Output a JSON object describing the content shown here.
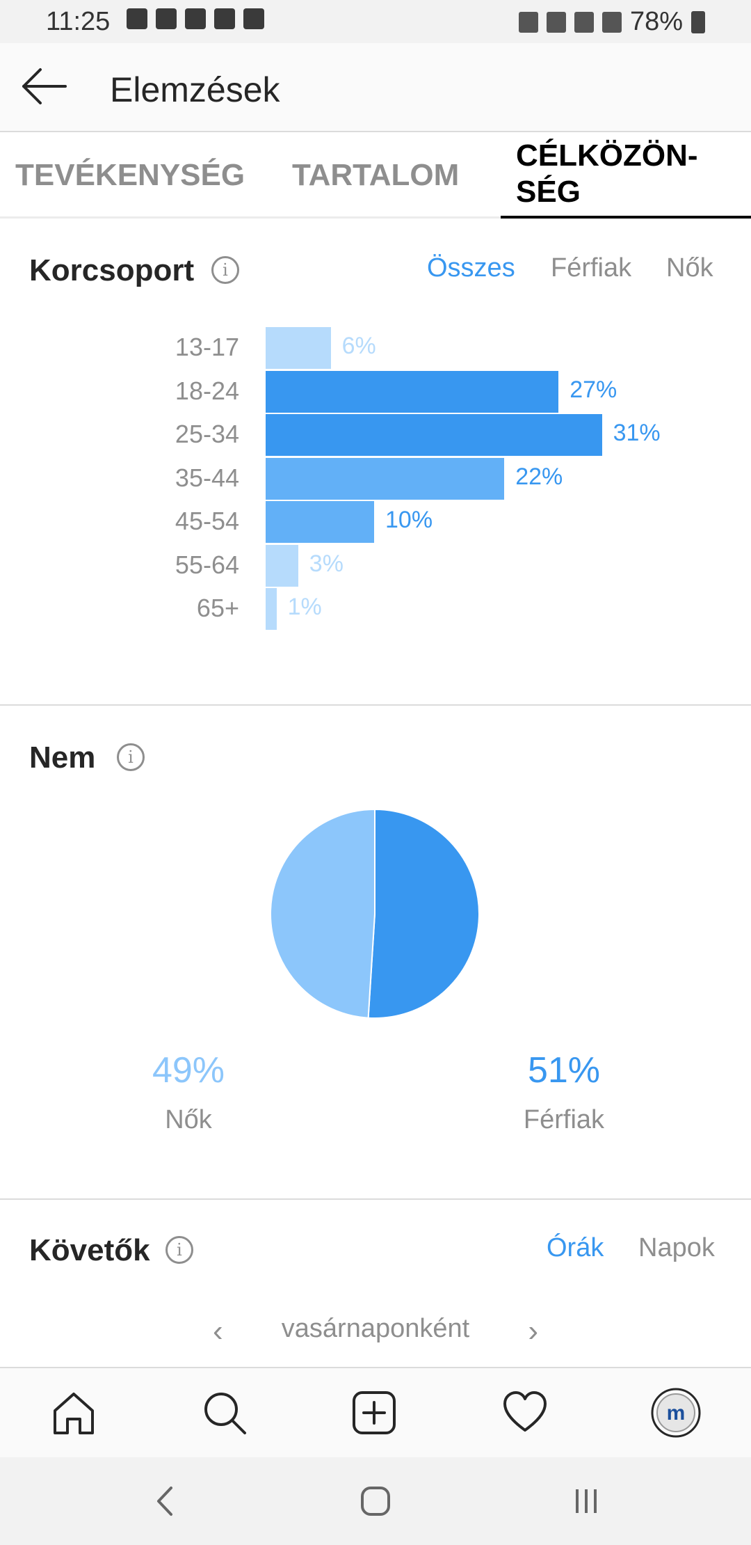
{
  "status_bar": {
    "time": "11:25",
    "battery": "78%",
    "notification_icons": [
      "news-icon",
      "gmail-icon",
      "person-icon",
      "gallery-icon",
      "maps-icon"
    ],
    "system_icons": [
      "bluetooth-icon",
      "mute-icon",
      "wifi-icon",
      "signal-icon",
      "battery-icon"
    ]
  },
  "header": {
    "title": "Elemzések",
    "back_icon": "arrow-left-icon"
  },
  "tabs": [
    {
      "label": "TEVÉKENYSÉG",
      "active": false
    },
    {
      "label": "TARTALOM",
      "active": false
    },
    {
      "label": "CÉLKÖZÖN-\nSÉG",
      "active": true
    }
  ],
  "age_section": {
    "title": "Korcsoport",
    "filters": [
      {
        "label": "Összes",
        "active": true
      },
      {
        "label": "Férfiak",
        "active": false
      },
      {
        "label": "Nők",
        "active": false
      }
    ]
  },
  "gender_section": {
    "title": "Nem",
    "women": {
      "pct": "49%",
      "label": "Nők"
    },
    "men": {
      "pct": "51%",
      "label": "Férfiak"
    }
  },
  "followers_section": {
    "title": "Követők",
    "filters": [
      {
        "label": "Órák",
        "active": true
      },
      {
        "label": "Napok",
        "active": false
      }
    ],
    "day_selector": "vasárnaponként"
  },
  "colors": {
    "accent": "#3897f0",
    "bar_dark": "#3897f0",
    "bar_mid": "#62b0f7",
    "bar_light": "#b6dbfc",
    "pie_men": "#3897f0",
    "pie_women": "#8cc6fb"
  },
  "chart_data": [
    {
      "type": "bar",
      "orientation": "horizontal",
      "title": "Korcsoport",
      "categories": [
        "13-17",
        "18-24",
        "25-34",
        "35-44",
        "45-54",
        "55-64",
        "65+"
      ],
      "values": [
        6,
        27,
        31,
        22,
        10,
        3,
        1
      ],
      "value_labels": [
        "6%",
        "27%",
        "31%",
        "22%",
        "10%",
        "3%",
        "1%"
      ],
      "unit": "%"
    },
    {
      "type": "pie",
      "title": "Nem",
      "categories": [
        "Nők",
        "Férfiak"
      ],
      "values": [
        49,
        51
      ]
    }
  ],
  "bottom_nav": [
    "home-icon",
    "search-icon",
    "add-post-icon",
    "activity-heart-icon",
    "profile-avatar-icon"
  ]
}
